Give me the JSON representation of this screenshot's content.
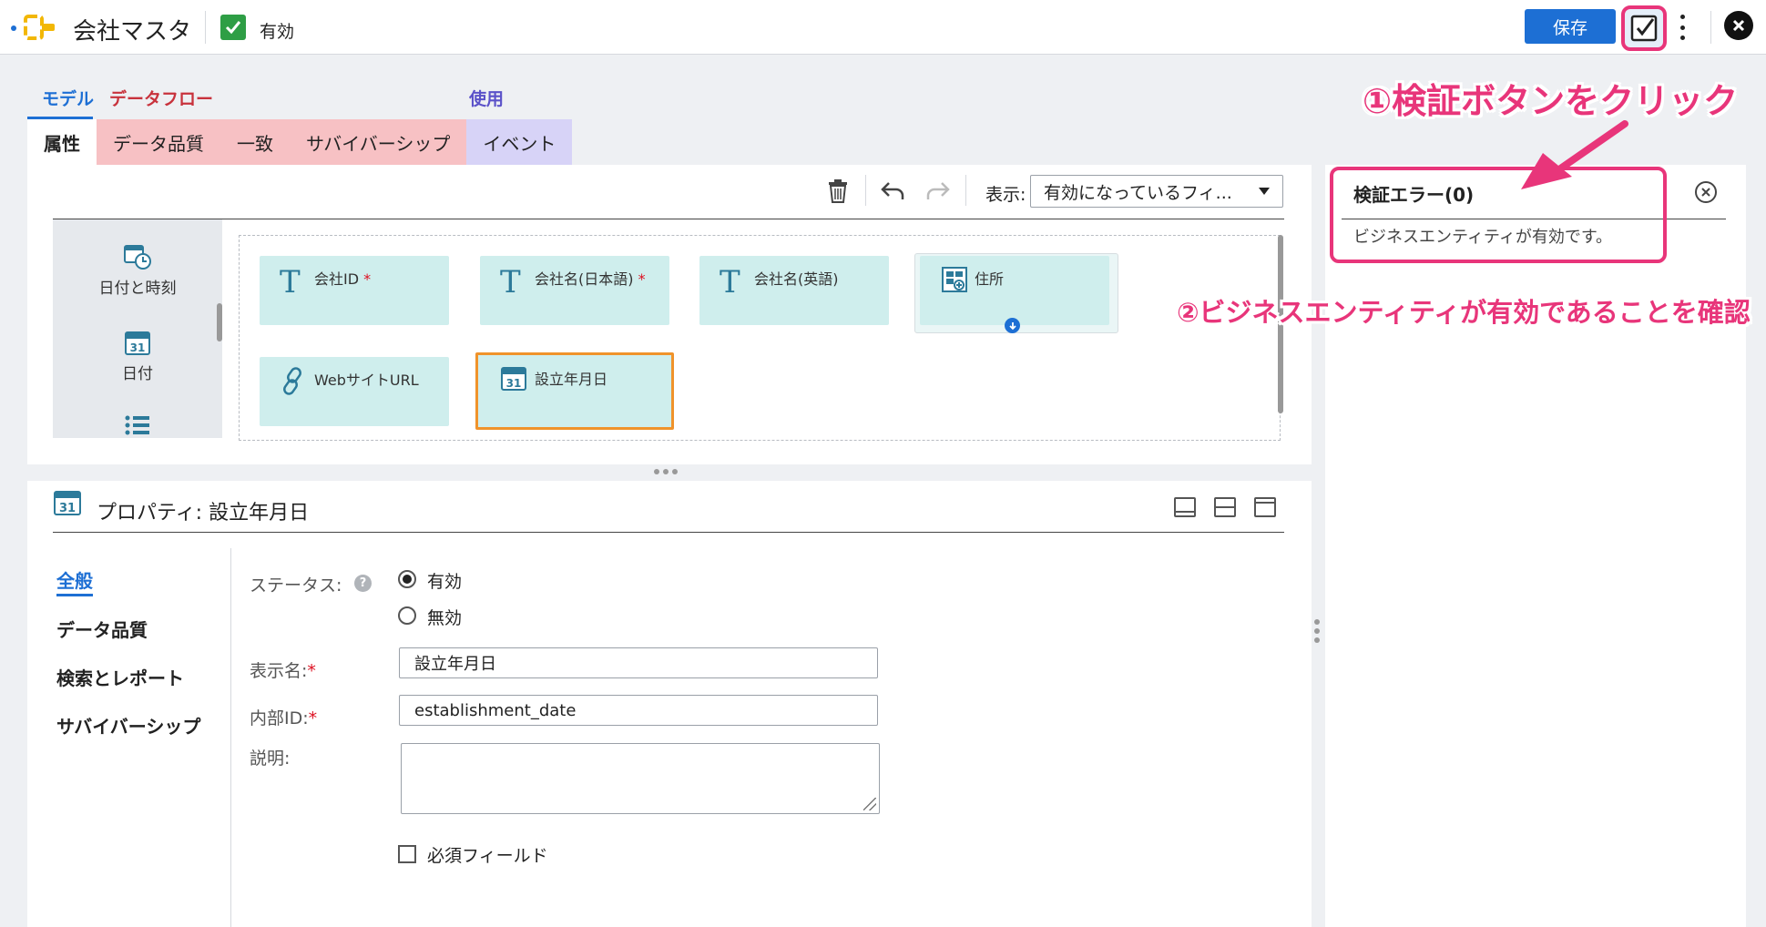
{
  "header": {
    "title": "会社マスタ",
    "status_label": "有効",
    "save_label": "保存"
  },
  "tabs": {
    "groups": {
      "model": "モデル",
      "dataflow": "データフロー",
      "use": "使用"
    },
    "items": [
      {
        "label": "属性",
        "active": true
      },
      {
        "label": "データ品質"
      },
      {
        "label": "一致"
      },
      {
        "label": "サバイバーシップ"
      },
      {
        "label": "イベント"
      }
    ]
  },
  "canvas": {
    "view_label": "表示:",
    "view_value": "有効になっているフィ...",
    "palette": [
      {
        "label": "日付と時刻",
        "icon": "datetime-icon"
      },
      {
        "label": "日付",
        "icon": "calendar-icon"
      },
      {
        "label": "",
        "icon": "list-icon"
      }
    ],
    "fields": [
      {
        "label": "会社ID",
        "required": "*",
        "icon": "text-type-icon"
      },
      {
        "label": "会社名(日本語)",
        "required": "*",
        "icon": "text-type-icon"
      },
      {
        "label": "会社名(英語)",
        "required": "",
        "icon": "text-type-icon"
      },
      {
        "label": "住所",
        "required": "",
        "icon": "group-icon"
      },
      {
        "label": "WebサイトURL",
        "required": "",
        "icon": "link-icon"
      },
      {
        "label": "設立年月日",
        "required": "",
        "icon": "calendar-icon",
        "selected": true
      }
    ]
  },
  "properties": {
    "title": "プロパティ: 設立年月日",
    "nav": [
      {
        "label": "全般",
        "active": true
      },
      {
        "label": "データ品質"
      },
      {
        "label": "検索とレポート"
      },
      {
        "label": "サバイバーシップ"
      }
    ],
    "status_label": "ステータス:",
    "status_options": [
      "有効",
      "無効"
    ],
    "status_selected": "有効",
    "display_name_label": "表示名:",
    "display_name_value": "設立年月日",
    "internal_id_label": "内部ID:",
    "internal_id_value": "establishment_date",
    "description_label": "説明:",
    "description_value": "",
    "required_field_label": "必須フィールド",
    "required_mark": "*"
  },
  "validation": {
    "title": "検証エラー(0)",
    "message": "ビジネスエンティティが有効です。"
  },
  "annotations": {
    "step1": "①検証ボタンをクリック",
    "step2": "②ビジネスエンティティが有効であることを確認",
    "color": "#e8357a"
  },
  "colors": {
    "accent": "#1d6fd4",
    "data_quality_tab": "#f7c1c4",
    "use_tab": "#d7d3f7",
    "field_card": "#cfeeed",
    "selected_border": "#f0932b",
    "status_green": "#2e9e45"
  }
}
